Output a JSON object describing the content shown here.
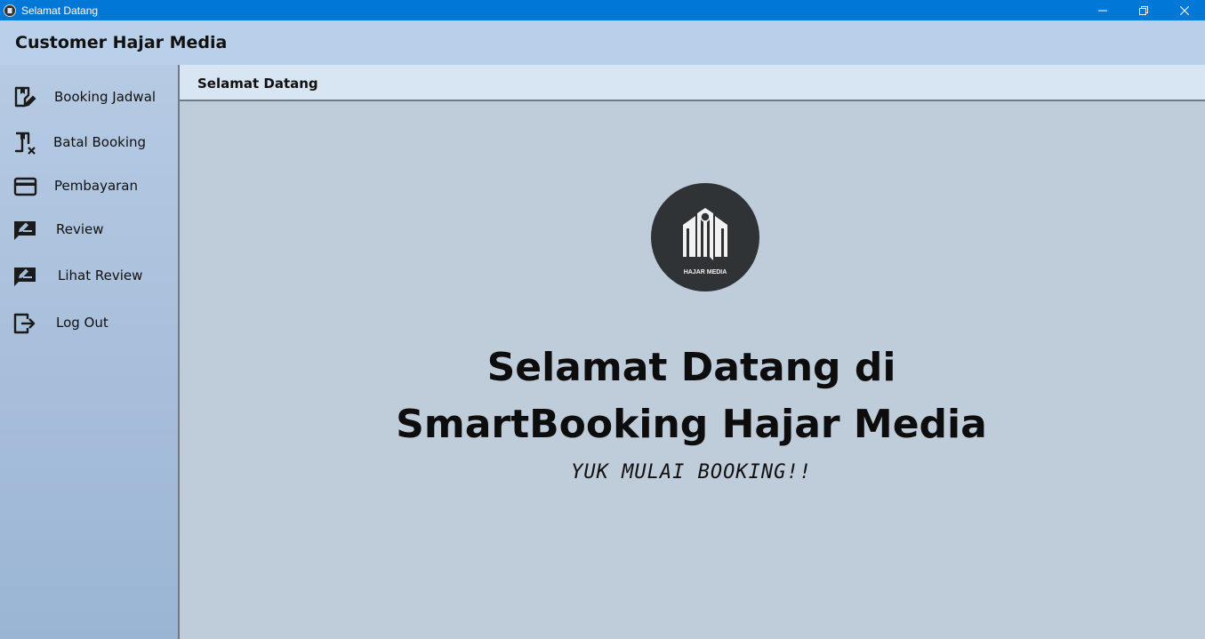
{
  "window": {
    "title": "Selamat Datang",
    "controls": [
      "minimize-icon",
      "restore-icon",
      "close-icon"
    ]
  },
  "header": {
    "title": "Customer Hajar Media"
  },
  "sidebar": {
    "items": [
      {
        "label": "Booking Jadwal",
        "icon": "booking-edit-icon"
      },
      {
        "label": "Batal Booking",
        "icon": "booking-cancel-icon"
      },
      {
        "label": "Pembayaran",
        "icon": "credit-card-icon"
      },
      {
        "label": "Review",
        "icon": "review-icon"
      },
      {
        "label": "Lihat Review",
        "icon": "review-icon"
      },
      {
        "label": "Log Out",
        "icon": "logout-icon"
      }
    ]
  },
  "tab": {
    "label": "Selamat Datang"
  },
  "main": {
    "logo_text": "HAJAR MEDIA",
    "heading_line1": "Selamat Datang di",
    "heading_line2": "SmartBooking Hajar Media",
    "subtitle": "YUK MULAI BOOKING!!"
  },
  "colors": {
    "titlebar": "#0078d7",
    "header": "#b8d0ea",
    "sidebar_top": "#b6cae3",
    "sidebar_bottom": "#9ab5d4",
    "content": "#bfccd9",
    "logo_bg": "#2f3336"
  }
}
